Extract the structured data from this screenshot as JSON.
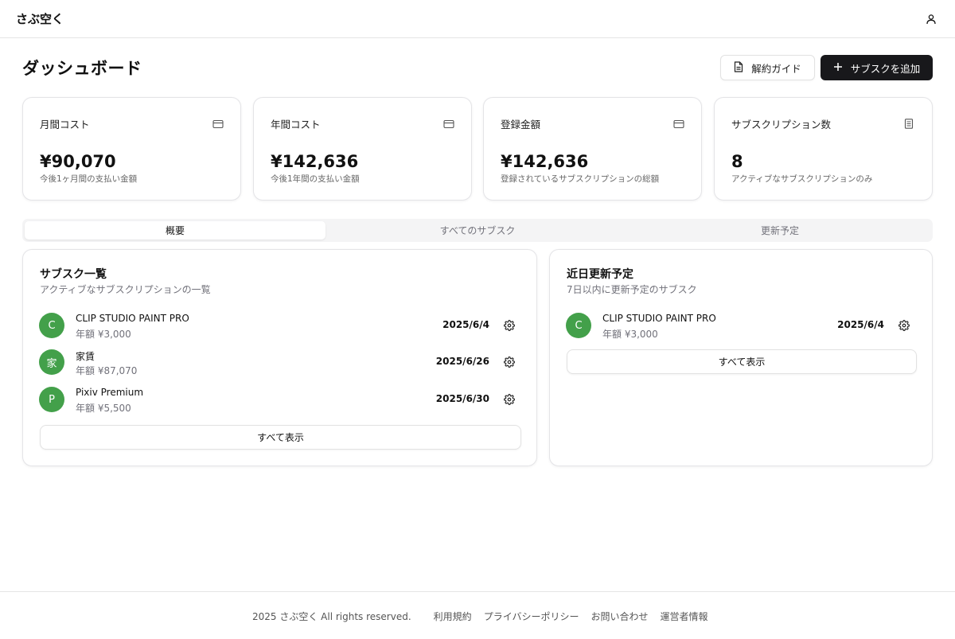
{
  "app": {
    "logo": "さぶ空く"
  },
  "page": {
    "title": "ダッシュボード",
    "guide_label": "解約ガイド",
    "add_label": "サブスクを追加"
  },
  "stats": [
    {
      "title": "月間コスト",
      "value": "¥90,070",
      "sub": "今後1ヶ月間の支払い金額",
      "icon": "credit-card-icon"
    },
    {
      "title": "年間コスト",
      "value": "¥142,636",
      "sub": "今後1年間の支払い金額",
      "icon": "credit-card-icon"
    },
    {
      "title": "登録金額",
      "value": "¥142,636",
      "sub": "登録されているサブスクリプションの総額",
      "icon": "credit-card-icon"
    },
    {
      "title": "サブスクリプション数",
      "value": "8",
      "sub": "アクティブなサブスクリプションのみ",
      "icon": "document-icon"
    }
  ],
  "tabs": [
    {
      "label": "概要",
      "active": true
    },
    {
      "label": "すべてのサブスク",
      "active": false
    },
    {
      "label": "更新予定",
      "active": false
    }
  ],
  "subs_panel": {
    "title": "サブスク一覧",
    "desc": "アクティブなサブスクリプションの一覧",
    "items": [
      {
        "initial": "C",
        "name": "CLIP STUDIO PAINT PRO",
        "price": "年額 ¥3,000",
        "date": "2025/6/4"
      },
      {
        "initial": "家",
        "name": "家賃",
        "price": "年額 ¥87,070",
        "date": "2025/6/26"
      },
      {
        "initial": "P",
        "name": "Pixiv Premium",
        "price": "年額 ¥5,500",
        "date": "2025/6/30"
      }
    ],
    "show_all": "すべて表示"
  },
  "upcoming_panel": {
    "title": "近日更新予定",
    "desc": "7日以内に更新予定のサブスク",
    "items": [
      {
        "initial": "C",
        "name": "CLIP STUDIO PAINT PRO",
        "price": "年額 ¥3,000",
        "date": "2025/6/4"
      }
    ],
    "show_all": "すべて表示"
  },
  "footer": {
    "copyright": "2025 さぶ空く All rights reserved.",
    "links": [
      "利用規約",
      "プライバシーポリシー",
      "お問い合わせ",
      "運営者情報"
    ]
  },
  "colors": {
    "avatar": "#43a04a",
    "primary_button": "#18181b"
  }
}
